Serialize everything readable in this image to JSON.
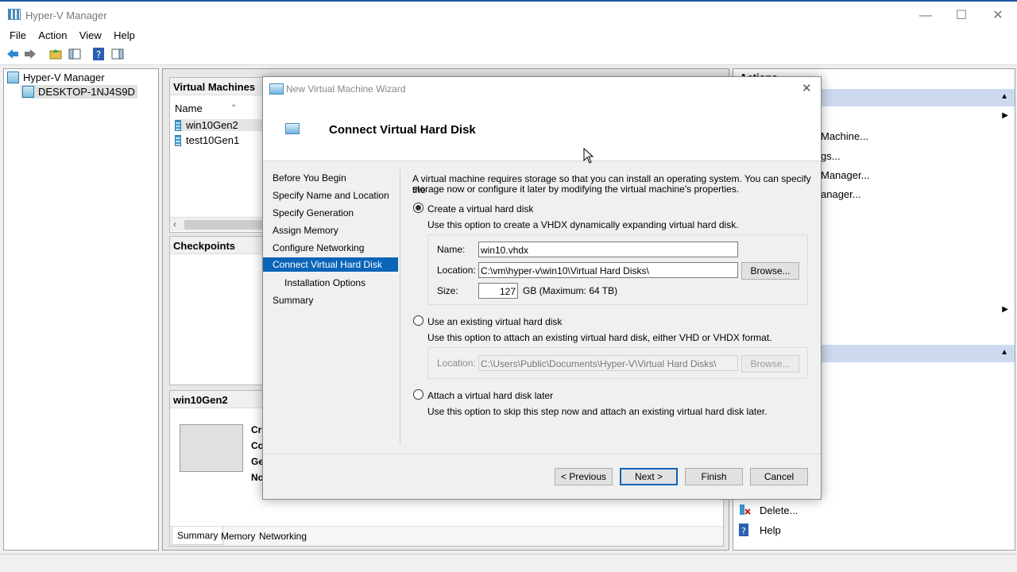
{
  "window": {
    "title": "Hyper-V Manager",
    "min": "—",
    "max": "☐",
    "close": "✕"
  },
  "menu": [
    "File",
    "Action",
    "View",
    "Help"
  ],
  "tree": {
    "root": "Hyper-V Manager",
    "server": "DESKTOP-1NJ4S9D"
  },
  "vm_panel": {
    "title": "Virtual Machines",
    "col_name": "Name",
    "vms": [
      "win10Gen2",
      "test10Gen1"
    ]
  },
  "checkpoints": {
    "title": "Checkpoints"
  },
  "details": {
    "title": "win10Gen2",
    "labels": [
      "Cre",
      "Co",
      "Ge",
      "No"
    ],
    "tabs": [
      "Summary",
      "Memory",
      "Networking"
    ]
  },
  "actions": {
    "header": "Actions",
    "items": [
      "Machine...",
      "gs...",
      "Manager...",
      "anager..."
    ],
    "delete": "Delete...",
    "help": "Help"
  },
  "wizard": {
    "title": "New Virtual Machine Wizard",
    "heading": "Connect Virtual Hard Disk",
    "steps": [
      "Before You Begin",
      "Specify Name and Location",
      "Specify Generation",
      "Assign Memory",
      "Configure Networking",
      "Connect Virtual Hard Disk",
      "Installation Options",
      "Summary"
    ],
    "intro_line1": "A virtual machine requires storage so that you can install an operating system. You can specify the",
    "intro_line2": "storage now or configure it later by modifying the virtual machine's properties.",
    "opt_create": {
      "label": "Create a virtual hard disk",
      "desc": "Use this option to create a VHDX dynamically expanding virtual hard disk."
    },
    "name_label": "Name:",
    "name_value": "win10.vhdx",
    "location_label": "Location:",
    "location_value": "C:\\vm\\hyper-v\\win10\\Virtual Hard Disks\\",
    "browse": "Browse...",
    "size_label": "Size:",
    "size_value": "127",
    "size_unit": "GB (Maximum: 64 TB)",
    "opt_existing": {
      "label": "Use an existing virtual hard disk",
      "desc": "Use this option to attach an existing virtual hard disk, either VHD or VHDX format."
    },
    "existing_location_value": "C:\\Users\\Public\\Documents\\Hyper-V\\Virtual Hard Disks\\",
    "opt_later": {
      "label": "Attach a virtual hard disk later",
      "desc": "Use this option to skip this step now and attach an existing virtual hard disk later."
    },
    "buttons": {
      "previous": "< Previous",
      "next": "Next >",
      "finish": "Finish",
      "cancel": "Cancel"
    }
  }
}
